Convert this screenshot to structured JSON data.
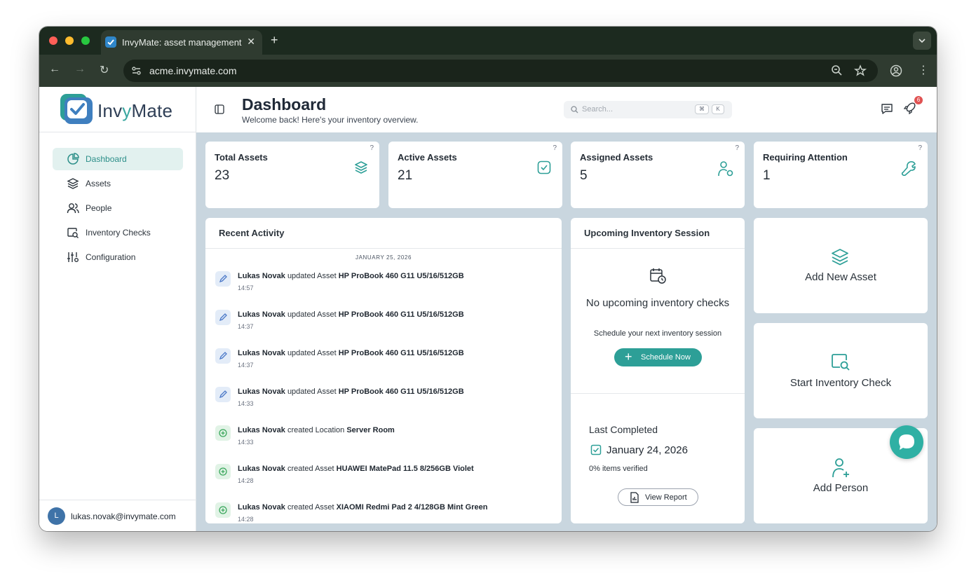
{
  "browser": {
    "tab_title": "InvyMate: asset management",
    "url": "acme.invymate.com"
  },
  "sidebar": {
    "logo_text_1": "Inv",
    "logo_text_2": "y",
    "logo_text_3": "Mate",
    "items": [
      {
        "label": "Dashboard",
        "icon": "pie-chart-icon",
        "active": true
      },
      {
        "label": "Assets",
        "icon": "layers-icon",
        "active": false
      },
      {
        "label": "People",
        "icon": "users-icon",
        "active": false
      },
      {
        "label": "Inventory Checks",
        "icon": "inventory-check-icon",
        "active": false
      },
      {
        "label": "Configuration",
        "icon": "sliders-icon",
        "active": false
      }
    ],
    "user": {
      "initial": "L",
      "email": "lukas.novak@invymate.com"
    }
  },
  "header": {
    "title": "Dashboard",
    "subtitle": "Welcome back! Here's your inventory overview.",
    "search_placeholder": "Search...",
    "shortcut_1": "⌘",
    "shortcut_2": "K",
    "notification_count": "6"
  },
  "stats": [
    {
      "title": "Total Assets",
      "value": "23",
      "help": "?",
      "icon": "layers-icon"
    },
    {
      "title": "Active Assets",
      "value": "21",
      "help": "?",
      "icon": "check-square-icon"
    },
    {
      "title": "Assigned Assets",
      "value": "5",
      "help": "?",
      "icon": "user-assigned-icon"
    },
    {
      "title": "Requiring Attention",
      "value": "1",
      "help": "?",
      "icon": "wrench-icon"
    }
  ],
  "recent_activity": {
    "title": "Recent Activity",
    "date": "JANUARY 25, 2026",
    "items": [
      {
        "type": "update",
        "user": "Lukas Novak",
        "action": "updated Asset",
        "target": "HP ProBook 460 G11 U5/16/512GB",
        "time": "14:57"
      },
      {
        "type": "update",
        "user": "Lukas Novak",
        "action": "updated Asset",
        "target": "HP ProBook 460 G11 U5/16/512GB",
        "time": "14:37"
      },
      {
        "type": "update",
        "user": "Lukas Novak",
        "action": "updated Asset",
        "target": "HP ProBook 460 G11 U5/16/512GB",
        "time": "14:37"
      },
      {
        "type": "update",
        "user": "Lukas Novak",
        "action": "updated Asset",
        "target": "HP ProBook 460 G11 U5/16/512GB",
        "time": "14:33"
      },
      {
        "type": "create",
        "user": "Lukas Novak",
        "action": "created Location",
        "target": "Server Room",
        "time": "14:33"
      },
      {
        "type": "create",
        "user": "Lukas Novak",
        "action": "created Asset",
        "target": "HUAWEI MatePad 11.5 8/256GB Violet",
        "time": "14:28"
      },
      {
        "type": "create",
        "user": "Lukas Novak",
        "action": "created Asset",
        "target": "XIAOMI Redmi Pad 2 4/128GB Mint Green",
        "time": "14:28"
      }
    ]
  },
  "upcoming": {
    "title": "Upcoming Inventory Session",
    "empty_title": "No upcoming inventory checks",
    "empty_subtitle": "Schedule your next inventory session",
    "schedule_button": "Schedule Now",
    "last_completed_label": "Last Completed",
    "last_completed_date": "January 24, 2026",
    "verified_text": "0% items verified",
    "report_button": "View Report"
  },
  "quick_actions": [
    {
      "label": "Add New Asset",
      "icon": "layers-icon"
    },
    {
      "label": "Start Inventory Check",
      "icon": "inventory-check-icon"
    },
    {
      "label": "Add Person",
      "icon": "add-person-icon"
    }
  ],
  "colors": {
    "accent": "#2d9f97",
    "brand_dark": "#2f3f56",
    "badge": "#e05252"
  }
}
